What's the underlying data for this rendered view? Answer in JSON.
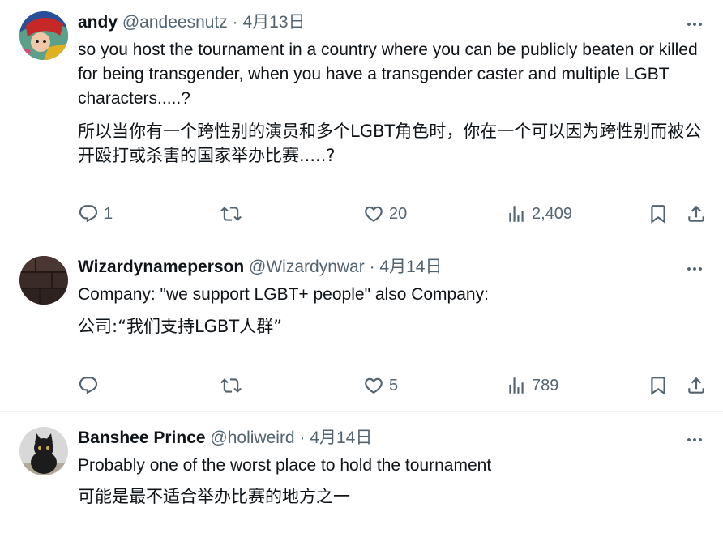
{
  "tweets": [
    {
      "name": "andy",
      "handle": "@andeesnutz",
      "dot": "·",
      "date": "4月13日",
      "text": "so you host the tournament in a country where you can be publicly beaten or killed for being transgender, when you have a transgender caster and multiple LGBT characters.....?",
      "translation": "所以当你有一个跨性别的演员和多个LGBT角色时，你在一个可以因为跨性别而被公开殴打或杀害的国家举办比赛.....?",
      "replies": "1",
      "retweets": "",
      "likes": "20",
      "views": "2,409"
    },
    {
      "name": "Wizardynameperson",
      "handle": "@Wizardynwar",
      "dot": "·",
      "date": "4月14日",
      "text": "Company: \"we support LGBT+ people\" also Company:",
      "translation": "公司:“我们支持LGBT人群”",
      "replies": "",
      "retweets": "",
      "likes": "5",
      "views": "789"
    },
    {
      "name": "Banshee Prince",
      "handle": "@holiweird",
      "dot": "·",
      "date": "4月14日",
      "text": "Probably one of the worst place to hold the tournament",
      "translation": "可能是最不适合举办比赛的地方之一"
    }
  ],
  "icons": {
    "reply": "reply-icon",
    "retweet": "retweet-icon",
    "like": "heart-icon",
    "views": "views-icon",
    "bookmark": "bookmark-icon",
    "share": "share-icon",
    "more": "more-icon"
  },
  "colors": {
    "text": "#0f1419",
    "secondary": "#536471",
    "divider": "#eff3f4"
  }
}
